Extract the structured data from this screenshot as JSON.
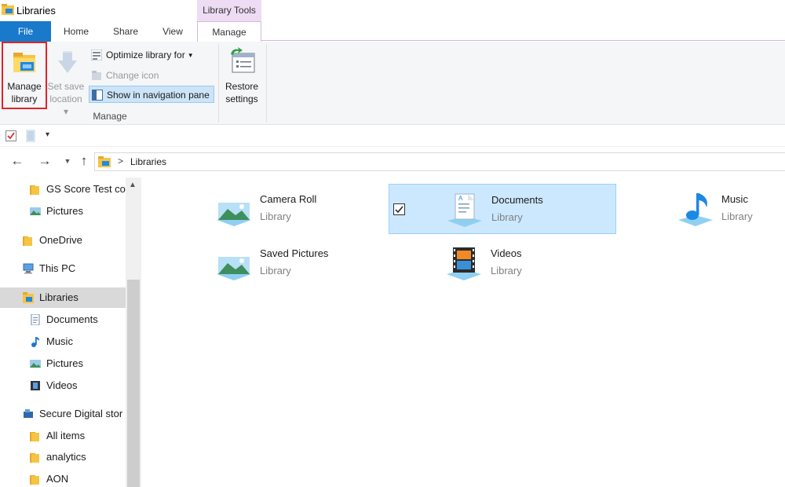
{
  "window": {
    "title": "Libraries",
    "context_tab_group": "Library Tools"
  },
  "tabs": [
    "File",
    "Home",
    "Share",
    "View",
    "Manage"
  ],
  "ribbon": {
    "manage_library": "Manage\nlibrary",
    "manage_library_l1": "Manage",
    "manage_library_l2": "library",
    "set_save_l1": "Set save",
    "set_save_l2": "location",
    "set_save_caret": "▾",
    "optimize": "Optimize library for",
    "change_icon": "Change icon",
    "show_nav": "Show in navigation pane",
    "group_manage": "Manage",
    "restore_l1": "Restore",
    "restore_l2": "settings"
  },
  "quick_access": {
    "dropdown_glyph": "▾"
  },
  "address": {
    "separator": ">",
    "crumb": "Libraries"
  },
  "nav_pane": {
    "items": [
      {
        "label": "GS Score Test co",
        "icon": "folder-icon"
      },
      {
        "label": "Pictures",
        "icon": "pictures-icon"
      },
      {
        "label": "OneDrive",
        "icon": "folder-icon"
      },
      {
        "label": "This PC",
        "icon": "computer-icon"
      },
      {
        "label": "Libraries",
        "icon": "libraries-icon",
        "selected": true
      },
      {
        "label": "Documents",
        "icon": "documents-icon"
      },
      {
        "label": "Music",
        "icon": "music-icon"
      },
      {
        "label": "Pictures",
        "icon": "pictures-icon"
      },
      {
        "label": "Videos",
        "icon": "videos-icon"
      },
      {
        "label": "Secure Digital stor",
        "icon": "drive-icon"
      },
      {
        "label": "All items",
        "icon": "folder-icon"
      },
      {
        "label": "analytics",
        "icon": "folder-icon"
      },
      {
        "label": "AON",
        "icon": "folder-icon"
      }
    ]
  },
  "libraries": [
    {
      "name": "Camera Roll",
      "type": "Library",
      "icon": "camera-roll-icon"
    },
    {
      "name": "Documents",
      "type": "Library",
      "icon": "documents-library-icon",
      "selected": true
    },
    {
      "name": "Music",
      "type": "Library",
      "icon": "music-library-icon"
    },
    {
      "name": "Saved Pictures",
      "type": "Library",
      "icon": "saved-pictures-icon"
    },
    {
      "name": "Videos",
      "type": "Library",
      "icon": "videos-library-icon"
    }
  ],
  "colors": {
    "file_tab": "#1979ca",
    "context_tab": "#eedcf4",
    "highlight_border": "#e0242a",
    "selection": "#cce8ff"
  }
}
